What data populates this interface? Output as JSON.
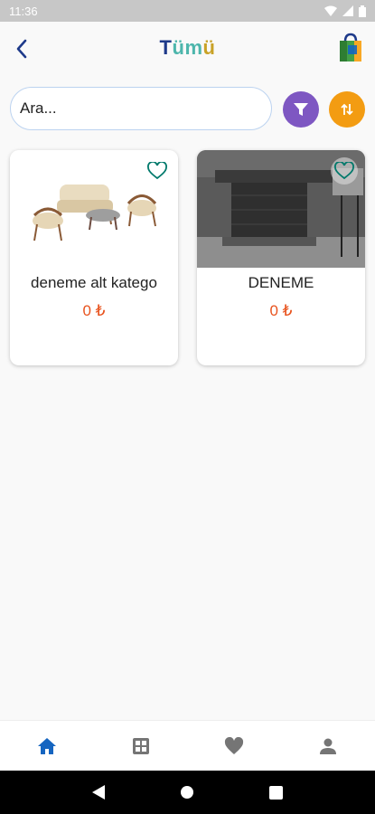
{
  "status_bar": {
    "time": "11:36"
  },
  "header": {
    "title_part1": "T",
    "title_part2": "üm",
    "title_part3": "ü"
  },
  "search": {
    "placeholder": "Ara..."
  },
  "products": [
    {
      "title": "deneme alt katego",
      "price": "0 ₺"
    },
    {
      "title": "DENEME",
      "price": "0 ₺"
    }
  ],
  "colors": {
    "accent_filter": "#7e57c2",
    "accent_sort": "#f39c12",
    "price": "#e8531e",
    "nav_active": "#1565c0",
    "nav_inactive": "#757575"
  },
  "icons": {
    "back": "chevron-left-icon",
    "cart": "shopping-bag-icon",
    "filter": "filter-icon",
    "sort": "sort-arrows-icon",
    "favorite": "heart-outline-icon",
    "nav": [
      "home-icon",
      "grid-icon",
      "heart-icon",
      "person-icon"
    ]
  }
}
